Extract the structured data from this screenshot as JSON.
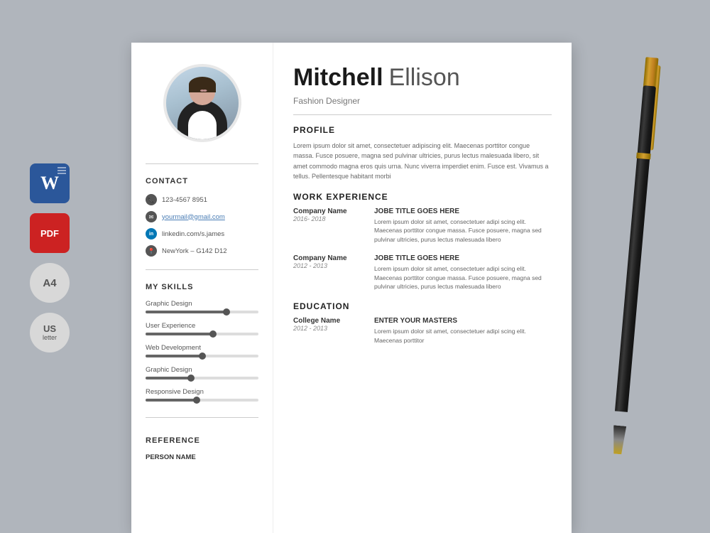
{
  "page": {
    "background_color": "#b0b5bc"
  },
  "side_icons": [
    {
      "id": "word",
      "label": "W",
      "sub": "",
      "type": "word"
    },
    {
      "id": "pdf",
      "label": "PDF",
      "sub": "",
      "type": "pdf"
    },
    {
      "id": "a4",
      "label": "A4",
      "sub": "",
      "type": "a4"
    },
    {
      "id": "us",
      "label": "US",
      "sub": "letter",
      "type": "us"
    }
  ],
  "resume": {
    "first_name": "Mitchell",
    "last_name": "Ellison",
    "job_title": "Fashion Designer",
    "contact": {
      "label": "CONTACT",
      "phone": "123-4567 8951",
      "email": "yourmail@gmail.com",
      "linkedin": "linkedin.com/s.james",
      "location": "NewYork – G142 D12"
    },
    "skills": {
      "label": "MY SKILLS",
      "items": [
        {
          "name": "Graphic Design",
          "percent": 72
        },
        {
          "name": "User Experience",
          "percent": 60
        },
        {
          "name": "Web Development",
          "percent": 50
        },
        {
          "name": "Graphic Design",
          "percent": 40
        },
        {
          "name": "Responsive Design",
          "percent": 45
        }
      ]
    },
    "reference": {
      "label": "REFERENCE",
      "sub_label": "PERSON NAME"
    },
    "profile": {
      "label": "PROFILE",
      "text": "Lorem ipsum dolor sit amet, consectetuer adipiscing elit. Maecenas porttitor congue massa. Fusce posuere, magna sed pulvinar ultricies, purus lectus malesuada libero, sit amet commodo magna eros quis urna. Nunc viverra imperdiet enim. Fusce est. Vivamus a tellus. Pellentesque habitant morbi"
    },
    "work_experience": {
      "label": "WORK EXPERIENCE",
      "items": [
        {
          "company": "Company Name",
          "dates": "2016- 2018",
          "title": "JOBE TITLE GOES HERE",
          "description": "Lorem ipsum dolor sit amet, consectetuer adipi scing elit. Maecenas porttitor congue massa. Fusce posuere, magna sed pulvinar ultricies, purus lectus malesuada libero"
        },
        {
          "company": "Company Name",
          "dates": "2012 - 2013",
          "title": "JOBE TITLE GOES HERE",
          "description": "Lorem ipsum dolor sit amet, consectetuer adipi scing elit. Maecenas porttitor congue massa. Fusce posuere, magna sed pulvinar ultricies, purus lectus malesuada libero"
        }
      ]
    },
    "education": {
      "label": "EDUCATION",
      "items": [
        {
          "college": "College Name",
          "dates": "2012 - 2013",
          "degree": "ENTER YOUR MASTERS",
          "description": "Lorem ipsum dolor sit amet, consectetuer adipi scing elit. Maecenas porttitor"
        }
      ]
    }
  }
}
